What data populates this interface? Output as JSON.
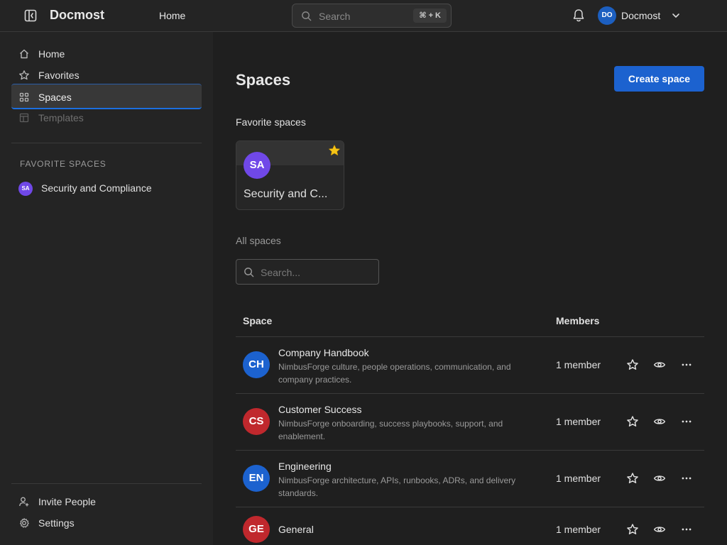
{
  "app": {
    "brand": "Docmost"
  },
  "topbar": {
    "home_label": "Home",
    "search_label": "Search",
    "search_shortcut": "⌘ + K",
    "user_initials": "DO",
    "user_name": "Docmost",
    "icons": [
      "sidebar-toggle-icon",
      "search-icon",
      "bell-icon",
      "chevron-down-icon"
    ]
  },
  "sidebar": {
    "items": [
      {
        "label": "Home",
        "icon": "home-icon"
      },
      {
        "label": "Favorites",
        "icon": "star-icon"
      },
      {
        "label": "Spaces",
        "icon": "grid-icon",
        "active": true
      },
      {
        "label": "Templates",
        "icon": "template-icon",
        "disabled": true
      }
    ],
    "favorite_spaces_title": "FAVORITE SPACES",
    "favorite_spaces": [
      {
        "initials": "SA",
        "name": "Security and Compliance",
        "color": "#7048e8"
      }
    ],
    "bottom": [
      {
        "label": "Invite People",
        "icon": "user-plus-icon"
      },
      {
        "label": "Settings",
        "icon": "gear-icon"
      }
    ]
  },
  "main": {
    "title": "Spaces",
    "create_button": "Create space",
    "favorite_heading": "Favorite spaces",
    "favorite_cards": [
      {
        "initials": "SA",
        "name": "Security and C...",
        "color": "#7048e8",
        "starred": true
      }
    ],
    "all_heading": "All spaces",
    "filter_placeholder": "Search...",
    "table": {
      "columns": [
        "Space",
        "Members"
      ],
      "rows": [
        {
          "initials": "CH",
          "color": "#1c62cf",
          "name": "Company Handbook",
          "description": "NimbusForge culture, people operations, communication, and company practices.",
          "members": "1 member"
        },
        {
          "initials": "CS",
          "color": "#c0282d",
          "name": "Customer Success",
          "description": "NimbusForge onboarding, success playbooks, support, and enablement.",
          "members": "1 member"
        },
        {
          "initials": "EN",
          "color": "#1c62cf",
          "name": "Engineering",
          "description": "NimbusForge architecture, APIs, runbooks, ADRs, and delivery standards.",
          "members": "1 member"
        },
        {
          "initials": "GE",
          "color": "#c0282d",
          "name": "General",
          "description": "",
          "members": "1 member"
        }
      ]
    }
  },
  "colors": {
    "accent": "#1c62cf",
    "star": "#f5c518",
    "background": "#1f1f1f",
    "sidebar": "#242424"
  }
}
